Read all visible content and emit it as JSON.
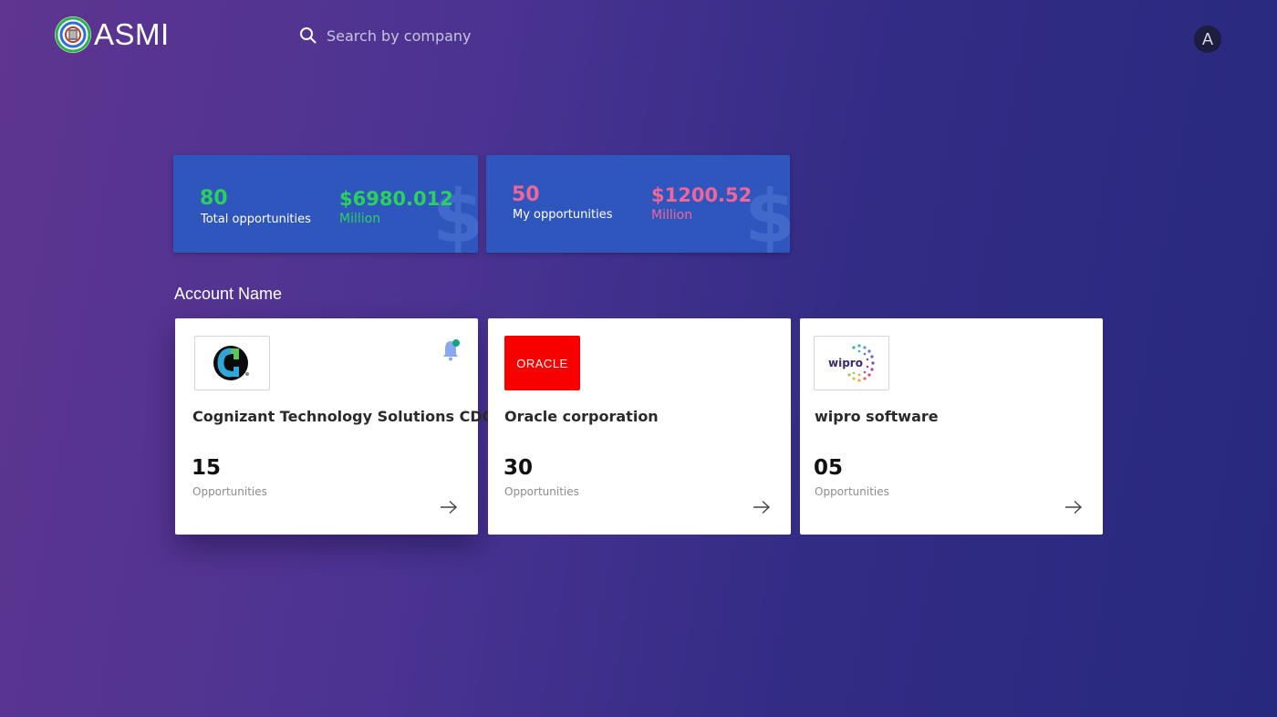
{
  "header": {
    "brand": "ASMI",
    "search_placeholder": "Search by company",
    "avatar_initial": "A"
  },
  "stats": [
    {
      "count": "80",
      "count_label": "Total opportunities",
      "amount": "$6980.012",
      "unit": "Million",
      "accent": "#2bd15e",
      "icon": "dollar-icon"
    },
    {
      "count": "50",
      "count_label": "My opportunities",
      "amount": "$1200.52",
      "unit": "Million",
      "accent": "#f0669a",
      "icon": "dollar-icon"
    }
  ],
  "section_title": "Account Name",
  "accounts": [
    {
      "name": "Cognizant Technology Solutions CDC",
      "count": "15",
      "count_label": "Opportunities",
      "logo": "cognizant-logo",
      "has_notification": true
    },
    {
      "name": "Oracle corporation",
      "count": "30",
      "count_label": "Opportunities",
      "logo": "oracle-logo",
      "logo_text": "ORACLE",
      "has_notification": false
    },
    {
      "name": "wipro software",
      "count": "05",
      "count_label": "Opportunities",
      "logo": "wipro-logo",
      "logo_text": "wipro",
      "has_notification": false
    }
  ],
  "colors": {
    "stat_card_bg": "#2f56bd",
    "green_accent": "#2bd15e",
    "pink_accent": "#f0669a",
    "oracle_red": "#f80000"
  }
}
